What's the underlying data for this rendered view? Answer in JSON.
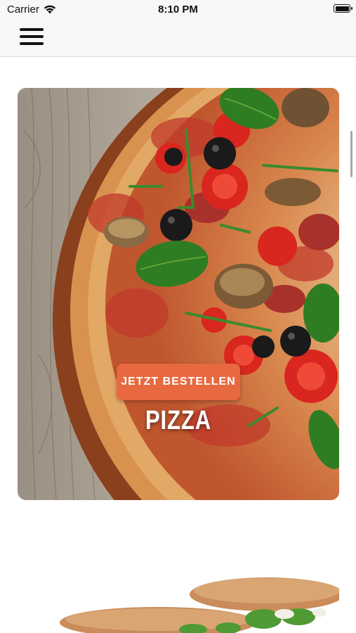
{
  "status_bar": {
    "carrier": "Carrier",
    "time": "8:10 PM"
  },
  "nav": {
    "menu_icon": "hamburger-menu-icon"
  },
  "hero_card": {
    "title": "PIZZA",
    "button_label": "JETZT BESTELLEN",
    "image": "pizza-photo",
    "button_color": "#e8693f"
  },
  "next_card": {
    "image": "sandwich-photo"
  }
}
